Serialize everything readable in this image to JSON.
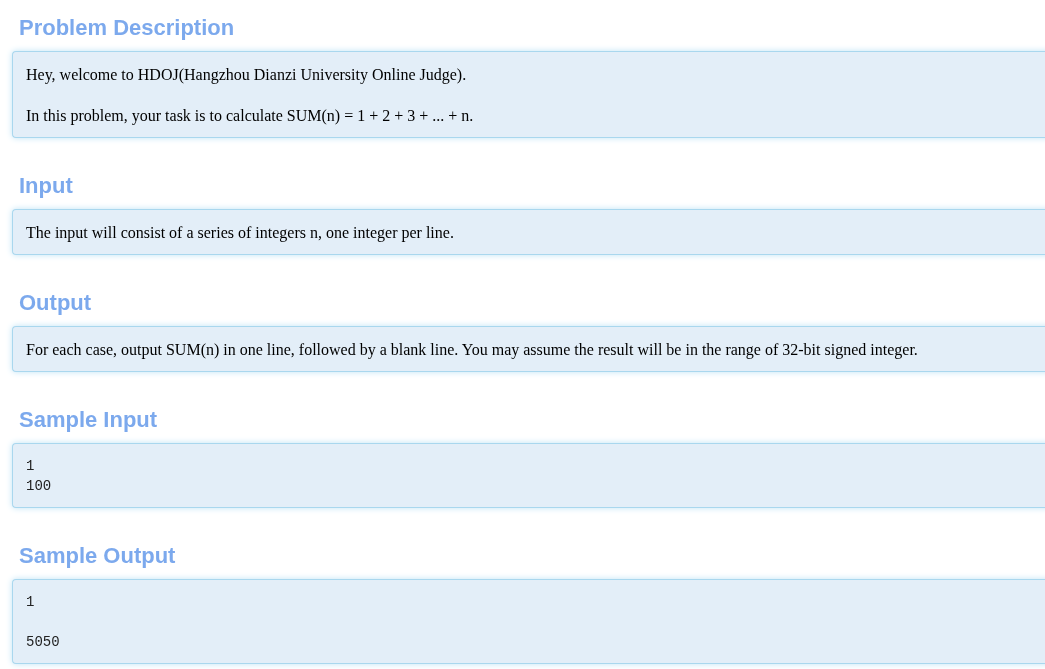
{
  "sections": [
    {
      "title": "Problem Description",
      "kind": "text",
      "paragraphs": [
        "Hey, welcome to HDOJ(Hangzhou Dianzi University Online Judge).",
        "In this problem, your task is to calculate SUM(n) = 1 + 2 + 3 + ... + n."
      ]
    },
    {
      "title": "Input",
      "kind": "text",
      "paragraphs": [
        "The input will consist of a series of integers n, one integer per line."
      ]
    },
    {
      "title": "Output",
      "kind": "text",
      "paragraphs": [
        "For each case, output SUM(n) in one line, followed by a blank line. You may assume the result will be in the range of 32-bit signed integer."
      ]
    },
    {
      "title": "Sample Input",
      "kind": "code",
      "code": "1\n100"
    },
    {
      "title": "Sample Output",
      "kind": "code",
      "code": "1\n\n5050"
    }
  ]
}
